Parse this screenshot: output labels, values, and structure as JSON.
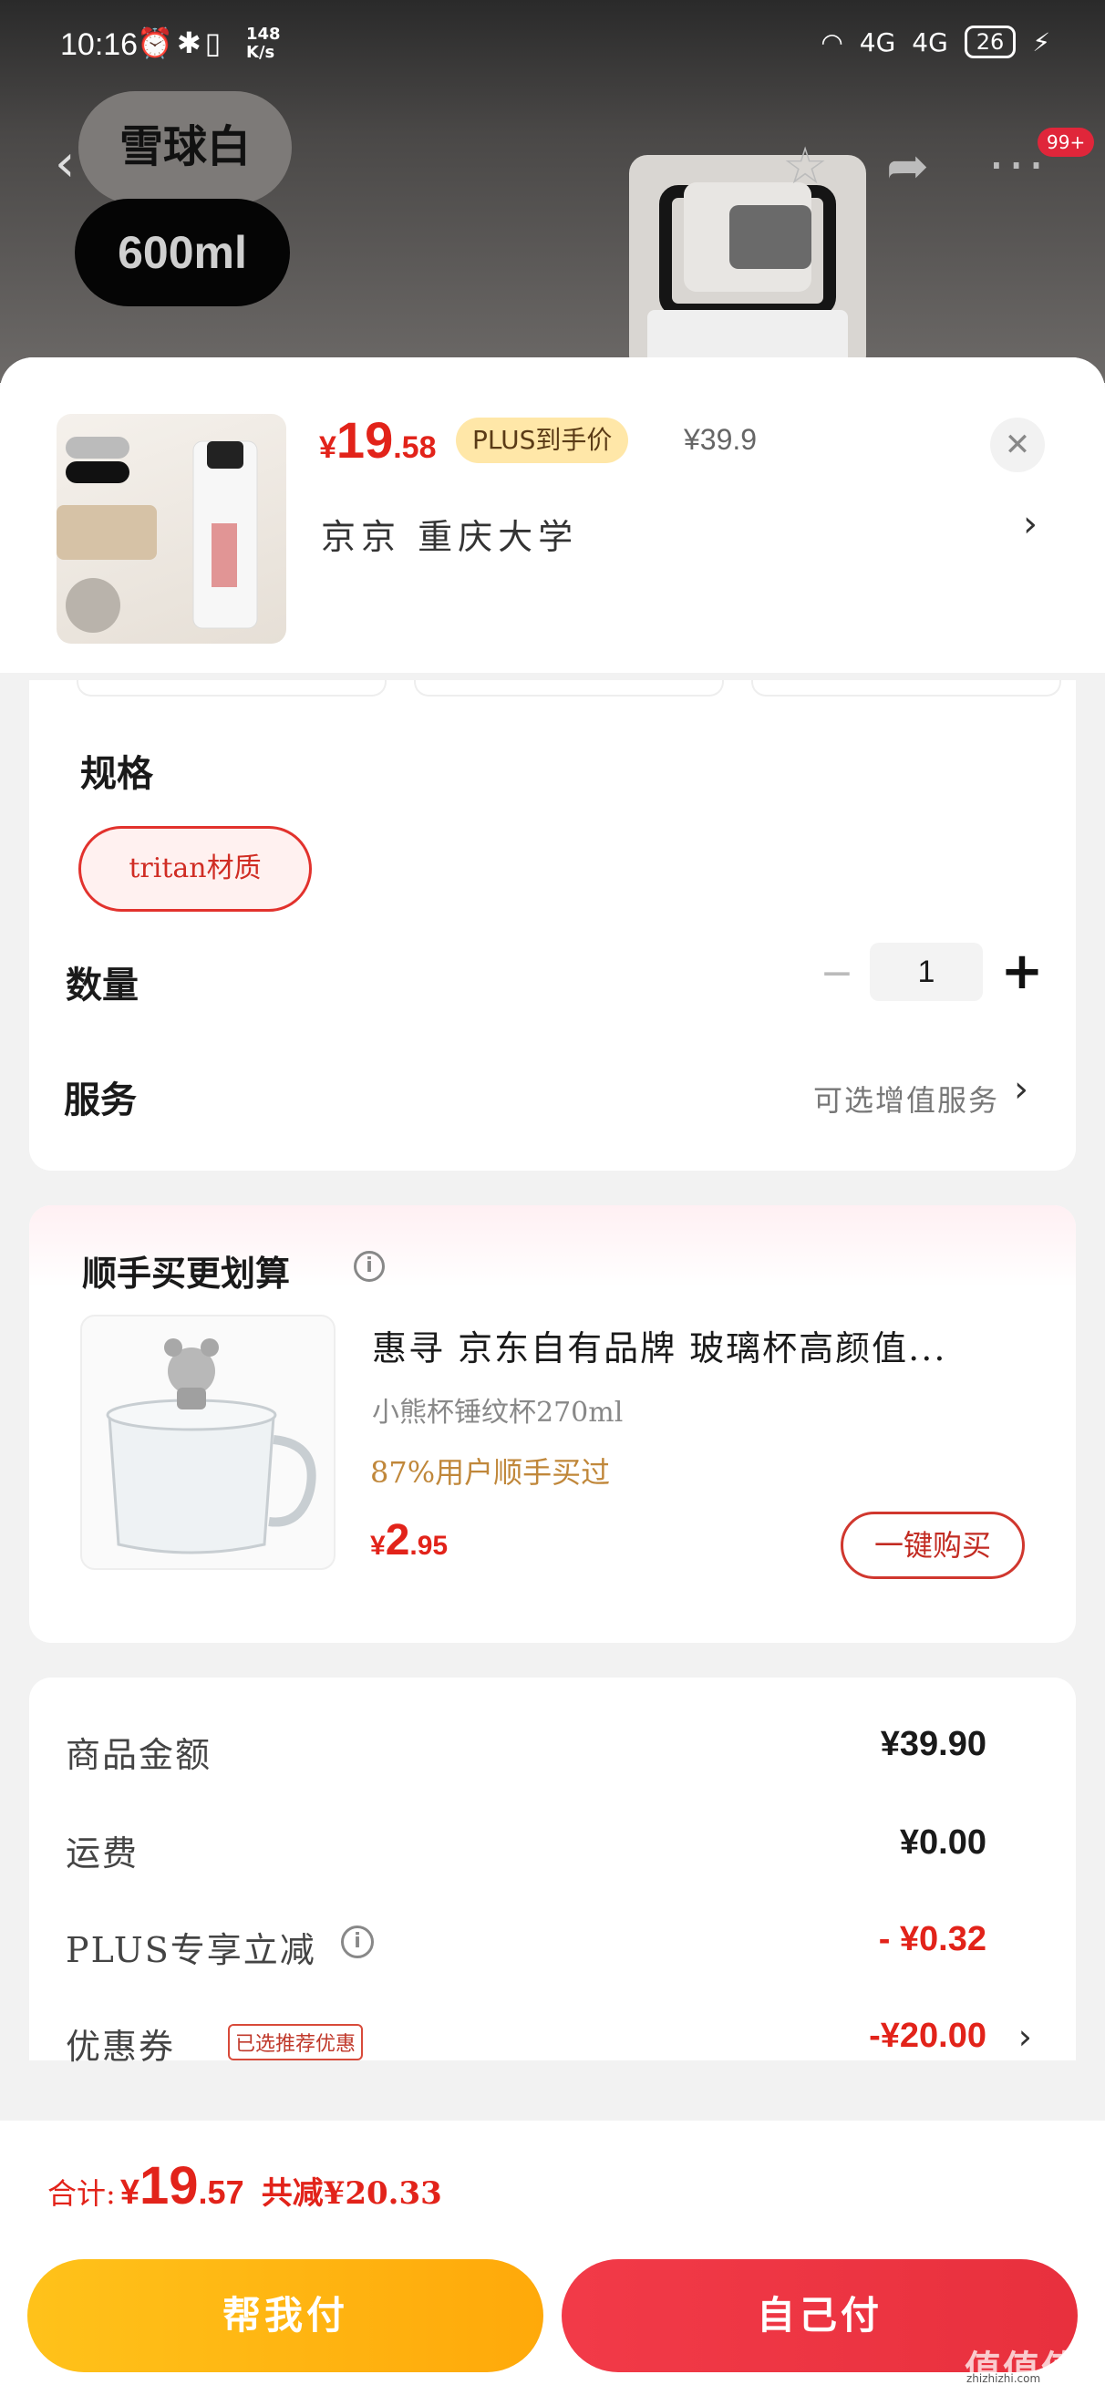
{
  "status_bar": {
    "time": "10:16",
    "speed": "148\nK/s",
    "net1": "4G",
    "net2": "4G",
    "battery": "26"
  },
  "header": {
    "color_label": "雪球白",
    "size_label": "600ml",
    "notif_badge": "99+"
  },
  "sheet": {
    "price_currency": "¥",
    "price_int": "19",
    "price_dec": ".58",
    "plus_tag": "PLUS到手价",
    "original_price": "¥39.9",
    "address": "京京  重庆大学",
    "close_icon": "close-icon"
  },
  "spec": {
    "title": "规格",
    "option": "tritan材质"
  },
  "quantity": {
    "title": "数量",
    "value": "1"
  },
  "service": {
    "title": "服务",
    "hint": "可选增值服务"
  },
  "recommend": {
    "title": "顺手买更划算",
    "item_name": "惠寻 京东自有品牌 玻璃杯高颜值...",
    "item_sub": "小熊杯锤纹杯270ml",
    "item_pct": "87%用户顺手买过",
    "price_currency": "¥",
    "price_int": "2",
    "price_dec": ".95",
    "buy_label": "一键购买"
  },
  "summary": {
    "rows": [
      {
        "label": "商品金额",
        "value": "¥39.90"
      },
      {
        "label": "运费",
        "value": "¥0.00"
      },
      {
        "label": "PLUS专享立减",
        "value": "- ¥0.32"
      },
      {
        "label": "优惠券",
        "tag": "已选推荐优惠",
        "value": "-¥20.00"
      }
    ]
  },
  "footer": {
    "total_label": "合计:",
    "total_currency": "¥",
    "total_int": "19",
    "total_dec": ".57",
    "total_save": "共减¥20.33",
    "help_pay": "帮我付",
    "self_pay": "自己付"
  },
  "watermark": {
    "text": "值值值",
    "sub": "zhizhizhi.com"
  },
  "colors": {
    "accent_red": "#e2231a",
    "plus_gold": "#ffe7a8",
    "help_yellow": "#ffb512"
  }
}
